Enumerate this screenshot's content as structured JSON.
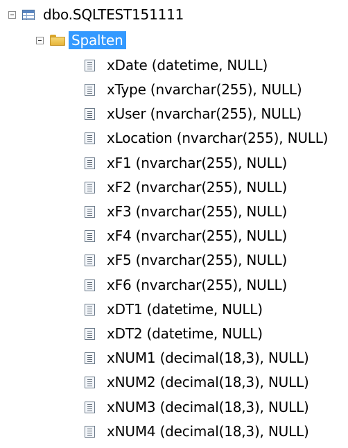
{
  "tree": {
    "table_label": "dbo.SQLTEST151111",
    "folder_label": "Spalten",
    "columns": [
      "xDate (datetime, NULL)",
      "xType (nvarchar(255), NULL)",
      "xUser (nvarchar(255), NULL)",
      "xLocation (nvarchar(255), NULL)",
      "xF1 (nvarchar(255), NULL)",
      "xF2 (nvarchar(255), NULL)",
      "xF3 (nvarchar(255), NULL)",
      "xF4 (nvarchar(255), NULL)",
      "xF5 (nvarchar(255), NULL)",
      "xF6 (nvarchar(255), NULL)",
      "xDT1 (datetime, NULL)",
      "xDT2 (datetime, NULL)",
      "xNUM1 (decimal(18,3), NULL)",
      "xNUM2 (decimal(18,3), NULL)",
      "xNUM3 (decimal(18,3), NULL)",
      "xNUM4 (decimal(18,3), NULL)"
    ],
    "selected_color": "#3399ff",
    "icons": {
      "expander": "collapse-minus-icon",
      "table": "table-icon",
      "folder": "folder-icon",
      "column": "column-icon"
    }
  }
}
